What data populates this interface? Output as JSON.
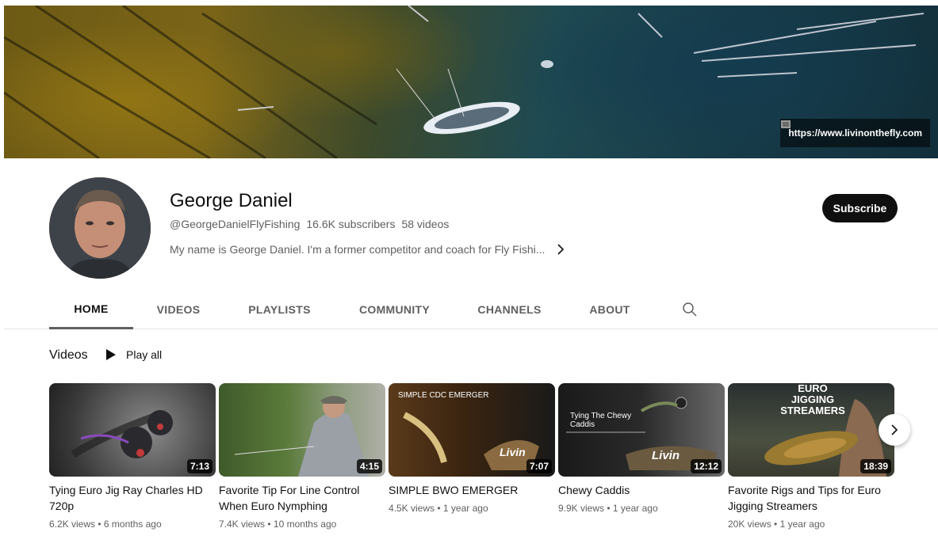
{
  "banner": {
    "link_text": "https://www.livinonthefly.com",
    "link_icon": "link-icon"
  },
  "channel": {
    "name": "George Daniel",
    "handle": "@GeorgeDanielFlyFishing",
    "subscribers": "16.6K subscribers",
    "videos": "58 videos",
    "description": "My name is George Daniel. I'm a former competitor and coach for Fly Fishi...",
    "subscribe_label": "Subscribe"
  },
  "tabs": [
    {
      "label": "HOME",
      "active": true
    },
    {
      "label": "VIDEOS",
      "active": false
    },
    {
      "label": "PLAYLISTS",
      "active": false
    },
    {
      "label": "COMMUNITY",
      "active": false
    },
    {
      "label": "CHANNELS",
      "active": false
    },
    {
      "label": "ABOUT",
      "active": false
    }
  ],
  "section": {
    "title": "Videos",
    "play_all": "Play all"
  },
  "videos": [
    {
      "title": "Tying Euro Jig Ray Charles HD 720p",
      "views": "6.2K views",
      "age": "6 months ago",
      "duration": "7:13",
      "overlay": ""
    },
    {
      "title": "Favorite Tip For Line Control When Euro Nymphing",
      "views": "7.4K views",
      "age": "10 months ago",
      "duration": "4:15",
      "overlay": ""
    },
    {
      "title": "SIMPLE BWO EMERGER",
      "views": "4.5K views",
      "age": "1 year ago",
      "duration": "7:07",
      "overlay": "SIMPLE CDC EMERGER"
    },
    {
      "title": "Chewy Caddis",
      "views": "9.9K views",
      "age": "1 year ago",
      "duration": "12:12",
      "overlay": "Tying The Chewy Caddis"
    },
    {
      "title": "Favorite Rigs and Tips for Euro Jigging Streamers",
      "views": "20K views",
      "age": "1 year ago",
      "duration": "18:39",
      "overlay": "EURO JIGGING STREAMERS"
    }
  ],
  "meta_separator": "•"
}
